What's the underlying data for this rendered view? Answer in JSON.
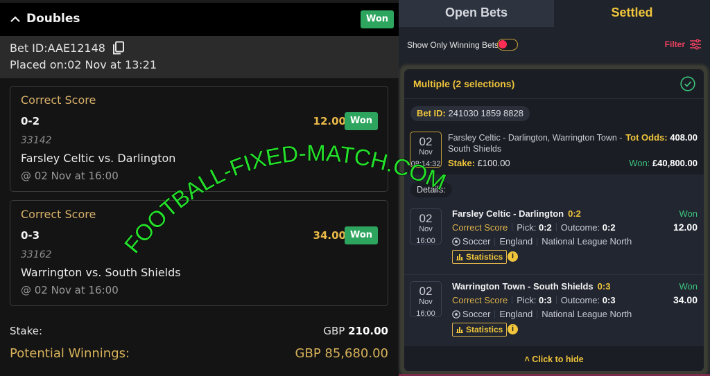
{
  "left": {
    "header": {
      "title": "Doubles",
      "status": "Won"
    },
    "bet_id": "Bet ID:AAE12148",
    "placed_on": "Placed on:02 Nov at 13:21",
    "selections": [
      {
        "market": "Correct Score",
        "score": "0-2",
        "odds": "12.00",
        "status": "Won",
        "code": "33142",
        "teams": "Farsley Celtic vs. Darlington",
        "when": "@ 02 Nov at 16:00"
      },
      {
        "market": "Correct Score",
        "score": "0-3",
        "odds": "34.00",
        "status": "Won",
        "code": "33162",
        "teams": "Warrington vs. South Shields",
        "when": "@ 02 Nov at 16:00"
      }
    ],
    "stake_label": "Stake:",
    "stake_currency": "GBP",
    "stake_value": "210.00",
    "winnings_label": "Potential Winnings:",
    "winnings_value": "GBP 85,680.00"
  },
  "right": {
    "tabs": [
      {
        "label": "Open Bets",
        "active": false
      },
      {
        "label": "Settled",
        "active": true
      }
    ],
    "filter_bar": {
      "toggle_label": "Show Only Winning Bets",
      "toggle_on": false,
      "filter_label": "Filter"
    },
    "bet": {
      "title": "Multiple (2 selections)",
      "bet_id_label": "Bet ID:",
      "bet_id": "241030 1859 8828",
      "date": {
        "day": "02",
        "month": "Nov",
        "time": "08:14:32"
      },
      "description": "Farsley Celtic - Darlington, Warrington Town - South Shields",
      "tot_odds_label": "Tot Odds:",
      "tot_odds": "408.00",
      "stake_label": "Stake:",
      "stake": "£100.00",
      "won_label": "Won:",
      "won": "£40,800.00",
      "details_label": "Details:",
      "legs": [
        {
          "date": {
            "day": "02",
            "month": "Nov",
            "time": "16:00"
          },
          "match": "Farsley Celtic - Darlington",
          "result": "0:2",
          "market": "Correct Score",
          "pick_label": "Pick:",
          "pick": "0:2",
          "outcome_label": "Outcome:",
          "outcome": "0:2",
          "sport": "Soccer",
          "country": "England",
          "league": "National League North",
          "stats_label": "Statistics",
          "info_glyph": "i",
          "status": "Won",
          "odds": "12.00"
        },
        {
          "date": {
            "day": "02",
            "month": "Nov",
            "time": "16:00"
          },
          "match": "Warrington Town - South Shields",
          "result": "0:3",
          "market": "Correct Score",
          "pick_label": "Pick:",
          "pick": "0:3",
          "outcome_label": "Outcome:",
          "outcome": "0:3",
          "sport": "Soccer",
          "country": "England",
          "league": "National League North",
          "stats_label": "Statistics",
          "info_glyph": "i",
          "status": "Won",
          "odds": "34.00"
        }
      ],
      "hide_label": "Click to hide"
    }
  },
  "watermark": "FOOTBALL-FIXED-MATCH.COM",
  "colors": {
    "won_green": "#2ea55f",
    "gold": "#f0c53b",
    "filter_red": "#e8405f",
    "watermark_green": "#25e02b"
  }
}
